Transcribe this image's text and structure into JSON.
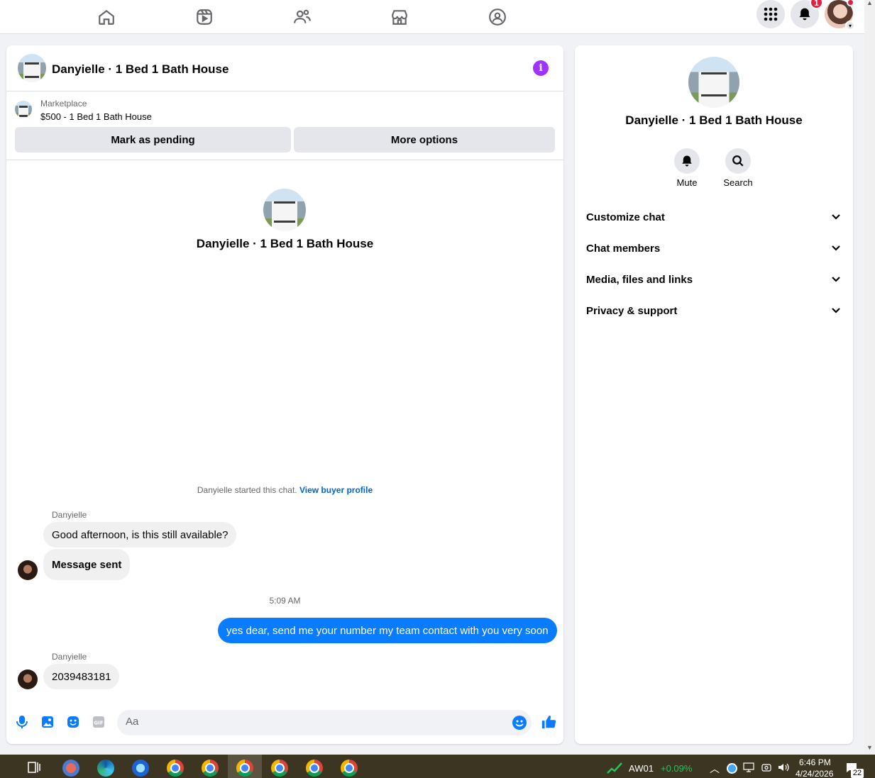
{
  "nav": {
    "items": [
      "home-icon",
      "video-icon",
      "friends-icon",
      "marketplace-icon",
      "groups-icon"
    ],
    "notification_count": "1"
  },
  "chat": {
    "title": "Danyielle · 1 Bed 1 Bath House",
    "listing_source": "Marketplace",
    "listing_title": "$500 - 1 Bed 1 Bath House",
    "mark_pending_label": "Mark as pending",
    "more_options_label": "More options",
    "intro_title": "Danyielle · 1 Bed 1 Bath House",
    "started_text": "Danyielle started this chat.",
    "view_profile_link": "View buyer profile",
    "messages": [
      {
        "sender": "Danyielle",
        "text": "Good afternoon, is this still available?"
      },
      {
        "text": "Message sent"
      },
      {
        "timestamp": "5:09 AM"
      },
      {
        "sender": "me",
        "text": "yes dear, send me your number my team contact with you very soon"
      },
      {
        "sender": "Danyielle",
        "text": "2039483181"
      }
    ],
    "composer_placeholder": "Aa"
  },
  "side": {
    "title": "Danyielle · 1 Bed 1 Bath House",
    "mute_label": "Mute",
    "search_label": "Search",
    "sections": [
      "Customize chat",
      "Chat members",
      "Media, files and links",
      "Privacy & support"
    ]
  },
  "taskbar": {
    "stock_symbol": "AW01",
    "stock_change": "+0.09%",
    "time": "6:46 PM",
    "date": "4/24/2026",
    "notification_count": "22"
  },
  "colors": {
    "accent_blue": "#0a7cff",
    "info_purple": "#a033ff",
    "stock_green": "#22c55e"
  }
}
